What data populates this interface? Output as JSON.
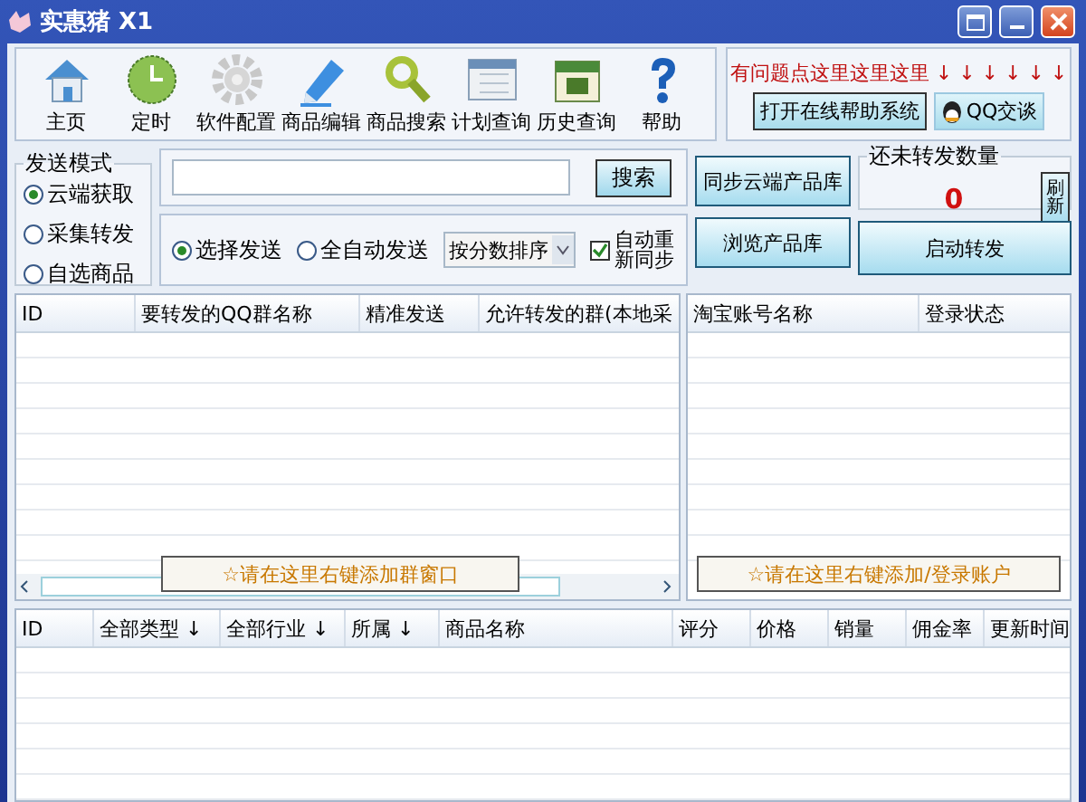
{
  "window": {
    "title": "实惠猪 X1"
  },
  "toolbar": [
    {
      "label": "主页"
    },
    {
      "label": "定时"
    },
    {
      "label": "软件配置"
    },
    {
      "label": "商品编辑"
    },
    {
      "label": "商品搜索"
    },
    {
      "label": "计划查询"
    },
    {
      "label": "历史查询"
    },
    {
      "label": "帮助"
    }
  ],
  "help_panel": {
    "notice": "有问题点这里这里这里 ↓ ↓ ↓ ↓ ↓ ↓",
    "buttons": [
      {
        "label": "打开在线帮助系统",
        "kind": "plain"
      },
      {
        "label": "QQ交谈",
        "kind": "qq"
      }
    ]
  },
  "send_mode": {
    "title": "发送模式",
    "options": [
      {
        "label": "云端获取",
        "selected": true
      },
      {
        "label": "采集转发",
        "selected": false
      },
      {
        "label": "自选商品",
        "selected": false
      }
    ]
  },
  "search": {
    "button": "搜索"
  },
  "send_options": [
    {
      "label": "选择发送",
      "selected": true
    },
    {
      "label": "全自动发送",
      "selected": false
    }
  ],
  "sort_dropdown": {
    "value": "按分数排序"
  },
  "auto_resync": {
    "label": "自动重新同步",
    "checked": true
  },
  "sync_button": "同步云端产品库",
  "browse_button": "浏览产品库",
  "counter": {
    "title": "还未转发数量",
    "value": "0",
    "refresh": "刷新"
  },
  "start_button": "启动转发",
  "group_table": {
    "columns": [
      "ID",
      "要转发的QQ群名称",
      "精准发送",
      "允许转发的群(本地采"
    ],
    "add_button": "☆请在这里右键添加群窗口"
  },
  "account_table": {
    "columns": [
      "淘宝账号名称",
      "登录状态"
    ],
    "add_button": "☆请在这里右键添加/登录账户"
  },
  "product_table": {
    "columns": [
      "ID",
      "全部类型 ↓",
      "全部行业 ↓",
      "所属 ↓",
      "商品名称",
      "评分",
      "价格",
      "销量",
      "佣金率",
      "更新时间"
    ]
  }
}
